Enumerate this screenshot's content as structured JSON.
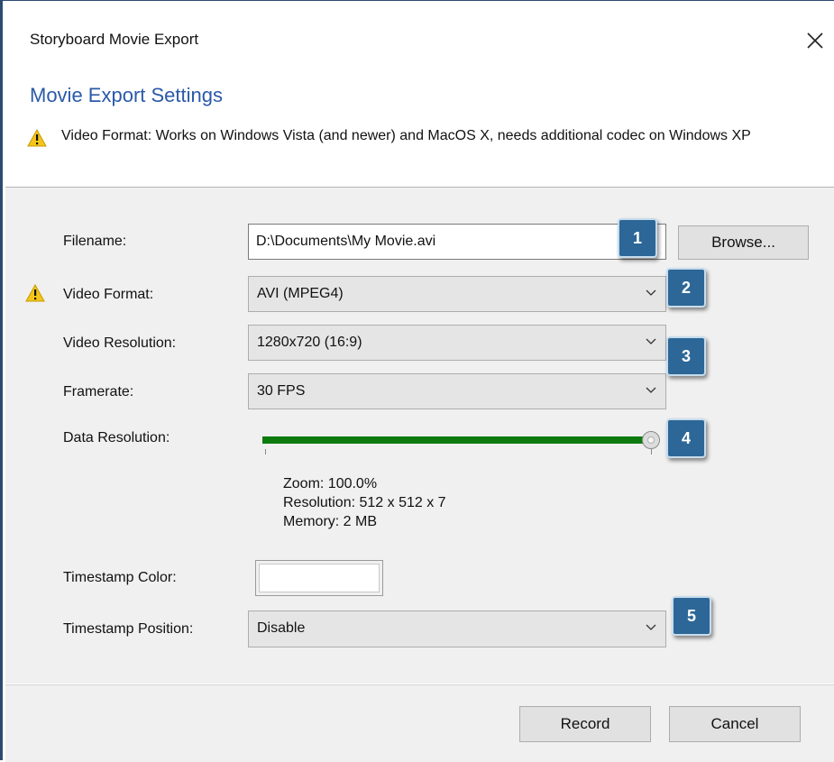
{
  "window": {
    "title": "Storyboard Movie Export"
  },
  "header": {
    "heading": "Movie Export Settings",
    "warning": "Video Format: Works on Windows Vista (and newer) and MacOS X, needs additional codec on Windows XP"
  },
  "form": {
    "filename": {
      "label": "Filename:",
      "value": "D:\\Documents\\My Movie.avi",
      "browse_label": "Browse..."
    },
    "video_format": {
      "label": "Video Format:",
      "value": "AVI (MPEG4)"
    },
    "video_resolution": {
      "label": "Video Resolution:",
      "value": "1280x720 (16:9)"
    },
    "framerate": {
      "label": "Framerate:",
      "value": "30 FPS"
    },
    "data_resolution": {
      "label": "Data Resolution:",
      "level": 1.0,
      "info": {
        "zoom": "Zoom: 100.0%",
        "resolution": "Resolution: 512 x 512 x 7",
        "memory": "Memory: 2 MB"
      }
    },
    "timestamp_color": {
      "label": "Timestamp Color:",
      "color": "#ffffff"
    },
    "timestamp_position": {
      "label": "Timestamp Position:",
      "value": "Disable"
    }
  },
  "callouts": [
    "1",
    "2",
    "3",
    "4",
    "5"
  ],
  "footer": {
    "record_label": "Record",
    "cancel_label": "Cancel"
  },
  "colors": {
    "heading": "#2b59a8",
    "slider_track": "#0d7a0d",
    "badge": "#2c6797",
    "warning": "#f5c518"
  },
  "icons": {
    "close": "close-icon",
    "warning": "warning-icon",
    "dropdown": "chevron-down-icon"
  }
}
